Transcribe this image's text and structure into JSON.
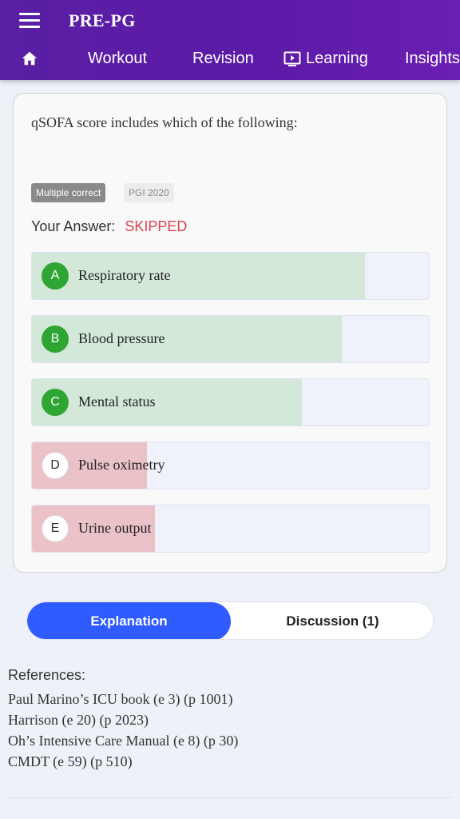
{
  "header": {
    "app_title": "PRE-PG",
    "nav": {
      "home_icon": "home-icon",
      "workout": "Workout",
      "revision": "Revision",
      "learning": "Learning",
      "learning_icon": "play-screen-icon",
      "insights": "Insights"
    }
  },
  "question": {
    "text": "qSOFA score includes which of the following:",
    "type_tag": "Multiple correct",
    "exam_tag": "PGI 2020",
    "your_answer_label": "Your Answer:",
    "your_answer_value": "SKIPPED",
    "options": [
      {
        "letter": "A",
        "text": "Respiratory rate",
        "status": "correct",
        "fill_fraction": 0.84
      },
      {
        "letter": "B",
        "text": "Blood pressure",
        "status": "correct",
        "fill_fraction": 0.78
      },
      {
        "letter": "C",
        "text": "Mental status",
        "status": "correct",
        "fill_fraction": 0.68
      },
      {
        "letter": "D",
        "text": "Pulse oximetry",
        "status": "wrong",
        "fill_fraction": 0.29
      },
      {
        "letter": "E",
        "text": "Urine output",
        "status": "wrong",
        "fill_fraction": 0.31
      }
    ]
  },
  "tabs": {
    "explanation": "Explanation",
    "discussion": "Discussion (1)"
  },
  "references": {
    "title": "References:",
    "items": [
      "Paul Marino’s ICU book (e 3) (p 1001)",
      "Harrison (e 20) (p 2023)",
      "Oh’s Intensive Care Manual (e 8) (p 30)",
      "CMDT (e 59) (p 510)"
    ]
  },
  "colors": {
    "header_purple": "#5a1fa4",
    "correct_green": "#2fa533",
    "skipped_red": "#d9434e",
    "tab_blue": "#2f5bff"
  }
}
